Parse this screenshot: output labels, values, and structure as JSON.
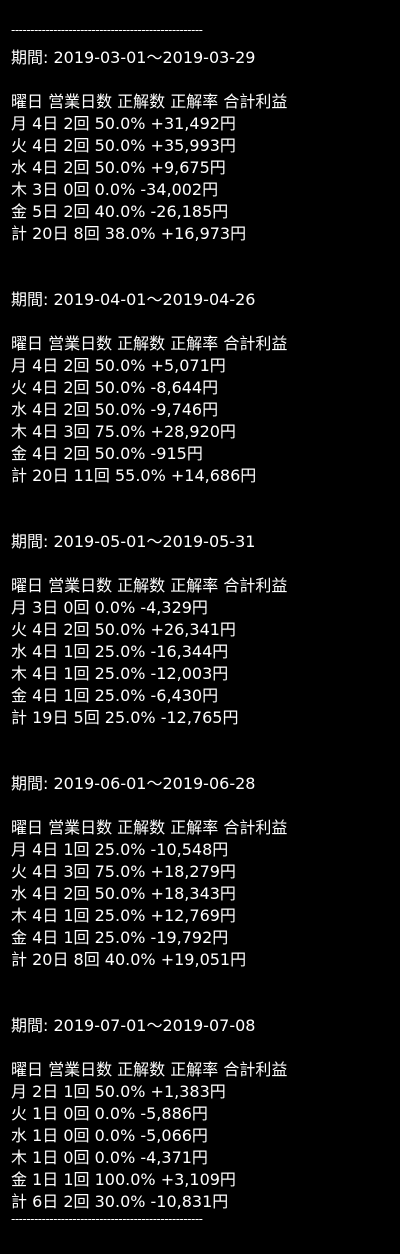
{
  "separator": "--------------------------------------------------",
  "periods": [
    {
      "period": "期間: 2019-03-01～2019-03-29",
      "header": "曜日 営業日数 正解数 正解率 合計利益",
      "rows": [
        "月 4日 2回 50.0% +31,492円",
        "火 4日 2回 50.0% +35,993円",
        "水 4日 2回 50.0% +9,675円",
        "木 3日 0回 0.0% -34,002円",
        "金 5日 2回 40.0% -26,185円",
        "計 20日 8回 38.0% +16,973円"
      ]
    },
    {
      "period": "期間: 2019-04-01～2019-04-26",
      "header": "曜日 営業日数 正解数 正解率 合計利益",
      "rows": [
        "月 4日 2回 50.0% +5,071円",
        "火 4日 2回 50.0% -8,644円",
        "水 4日 2回 50.0% -9,746円",
        "木 4日 3回 75.0% +28,920円",
        "金 4日 2回 50.0% -915円",
        "計 20日 11回 55.0% +14,686円"
      ]
    },
    {
      "period": "期間: 2019-05-01～2019-05-31",
      "header": "曜日 営業日数 正解数 正解率 合計利益",
      "rows": [
        "月 3日 0回 0.0% -4,329円",
        "火 4日 2回 50.0% +26,341円",
        "水 4日 1回 25.0% -16,344円",
        "木 4日 1回 25.0% -12,003円",
        "金 4日 1回 25.0% -6,430円",
        "計 19日 5回 25.0% -12,765円"
      ]
    },
    {
      "period": "期間: 2019-06-01～2019-06-28",
      "header": "曜日 営業日数 正解数 正解率 合計利益",
      "rows": [
        "月 4日 1回 25.0% -10,548円",
        "火 4日 3回 75.0% +18,279円",
        "水 4日 2回 50.0% +18,343円",
        "木 4日 1回 25.0% +12,769円",
        "金 4日 1回 25.0% -19,792円",
        "計 20日 8回 40.0% +19,051円"
      ]
    },
    {
      "period": "期間: 2019-07-01～2019-07-08",
      "header": "曜日 営業日数 正解数 正解率 合計利益",
      "rows": [
        "月 2日 1回 50.0% +1,383円",
        "火 1日 0回 0.0% -5,886円",
        "水 1日 0回 0.0% -5,066円",
        "木 1日 0回 0.0% -4,371円",
        "金 1日 1回 100.0% +3,109円",
        "計 6日 2回 30.0% -10,831円"
      ]
    }
  ]
}
